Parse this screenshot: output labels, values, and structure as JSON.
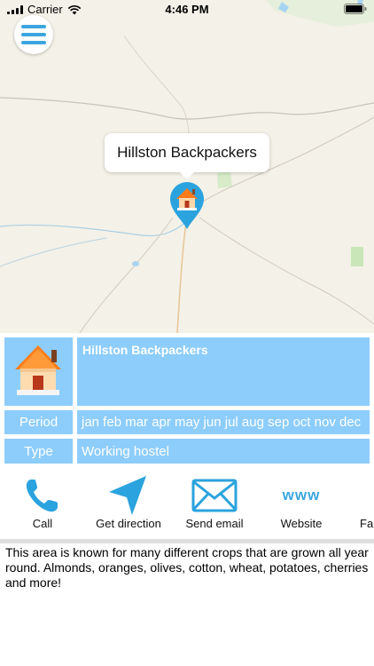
{
  "status_bar": {
    "carrier": "Carrier",
    "time": "4:46 PM"
  },
  "map": {
    "menu_icon": "hamburger-menu-icon",
    "callout_title": "Hillston Backpackers",
    "pin_icon": "house-pin-icon"
  },
  "details": {
    "icon": "house-icon",
    "title": "Hillston Backpackers",
    "period_label": "Period",
    "period_value": "jan feb mar apr may jun jul aug sep oct nov dec",
    "type_label": "Type",
    "type_value": "Working hostel"
  },
  "actions": [
    {
      "label": "Call",
      "icon": "phone-icon"
    },
    {
      "label": "Get direction",
      "icon": "navigation-arrow-icon"
    },
    {
      "label": "Send email",
      "icon": "envelope-icon"
    },
    {
      "label": "Website",
      "icon": "www",
      "icon_text": "www"
    },
    {
      "label": "Fa",
      "icon": "facebook-icon"
    }
  ],
  "description": "This area is known for many different crops that are grown all year round. Almonds, oranges, olives, cotton, wheat, potatoes, cherries and more!",
  "colors": {
    "accent": "#3aa6df",
    "cell_background": "#8dcdfb",
    "map_background": "#f4f1e8"
  }
}
